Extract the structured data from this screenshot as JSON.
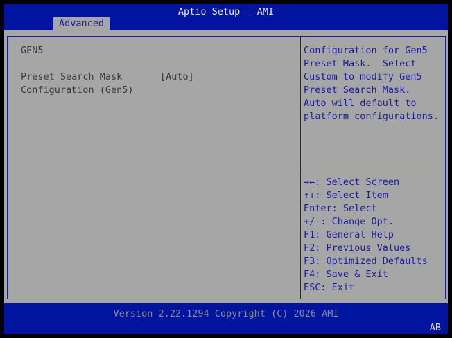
{
  "header": {
    "title": "Aptio Setup – AMI",
    "tabs": [
      {
        "label": "Advanced",
        "active": true
      }
    ]
  },
  "left": {
    "section_title": "GEN5",
    "setting": {
      "label_line1": "Preset Search Mask",
      "label_line2": "Configuration (Gen5)",
      "value": "[Auto]"
    }
  },
  "help": {
    "lines": [
      "Configuration for Gen5",
      "Preset Mask.  Select",
      "Custom to modify Gen5",
      "Preset Search Mask.",
      "Auto will default to",
      "platform configurations."
    ]
  },
  "keys": [
    "→←: Select Screen",
    "↑↓: Select Item",
    "Enter: Select",
    "+/-: Change Opt.",
    "F1: General Help",
    "F2: Previous Values",
    "F3: Optimized Defaults",
    "F4: Save & Exit",
    "ESC: Exit"
  ],
  "footer": {
    "version": "Version 2.22.1294 Copyright (C) 2026 AMI",
    "indicator": "AB"
  },
  "colors": {
    "header_blue": "#00149f",
    "panel_gray": "#a6a6a6",
    "text_blue": "#1c1ca0",
    "text_dark": "#3a3a3a"
  }
}
